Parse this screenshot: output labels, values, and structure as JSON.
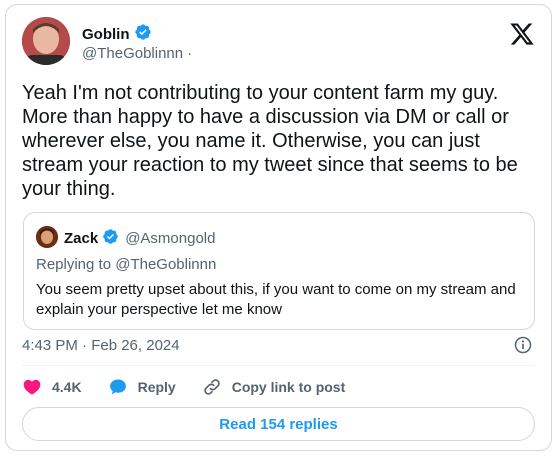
{
  "author": {
    "name": "Goblin",
    "handle": "@TheGoblinnn",
    "separator": "·",
    "avatar": "profile-photo"
  },
  "tweet": {
    "text": "Yeah I'm not contributing to your content farm my guy. More than happy to have a discussion via DM or call or wherever else, you name it. Otherwise, you can just stream your reaction to my tweet since that seems to be your thing.",
    "timestamp": "4:43 PM · Feb 26, 2024"
  },
  "quoted": {
    "name": "Zack",
    "handle": "@Asmongold",
    "replying_to": "Replying to @TheGoblinnn",
    "text": "You seem pretty upset about this, if you want to come on my stream and explain your perspective let me know"
  },
  "actions": {
    "likes": "4.4K",
    "reply_label": "Reply",
    "copy_link_label": "Copy link to post"
  },
  "read_replies_label": "Read 154 replies",
  "colors": {
    "verified": "#1d9bf0",
    "like": "#f91880",
    "reply_bubble": "#1d9bf0",
    "link": "#1d9bf0",
    "muted": "#536471"
  },
  "icons": [
    "verified-badge-icon",
    "x-logo-icon",
    "info-icon",
    "heart-icon",
    "reply-bubble-icon",
    "link-icon"
  ]
}
